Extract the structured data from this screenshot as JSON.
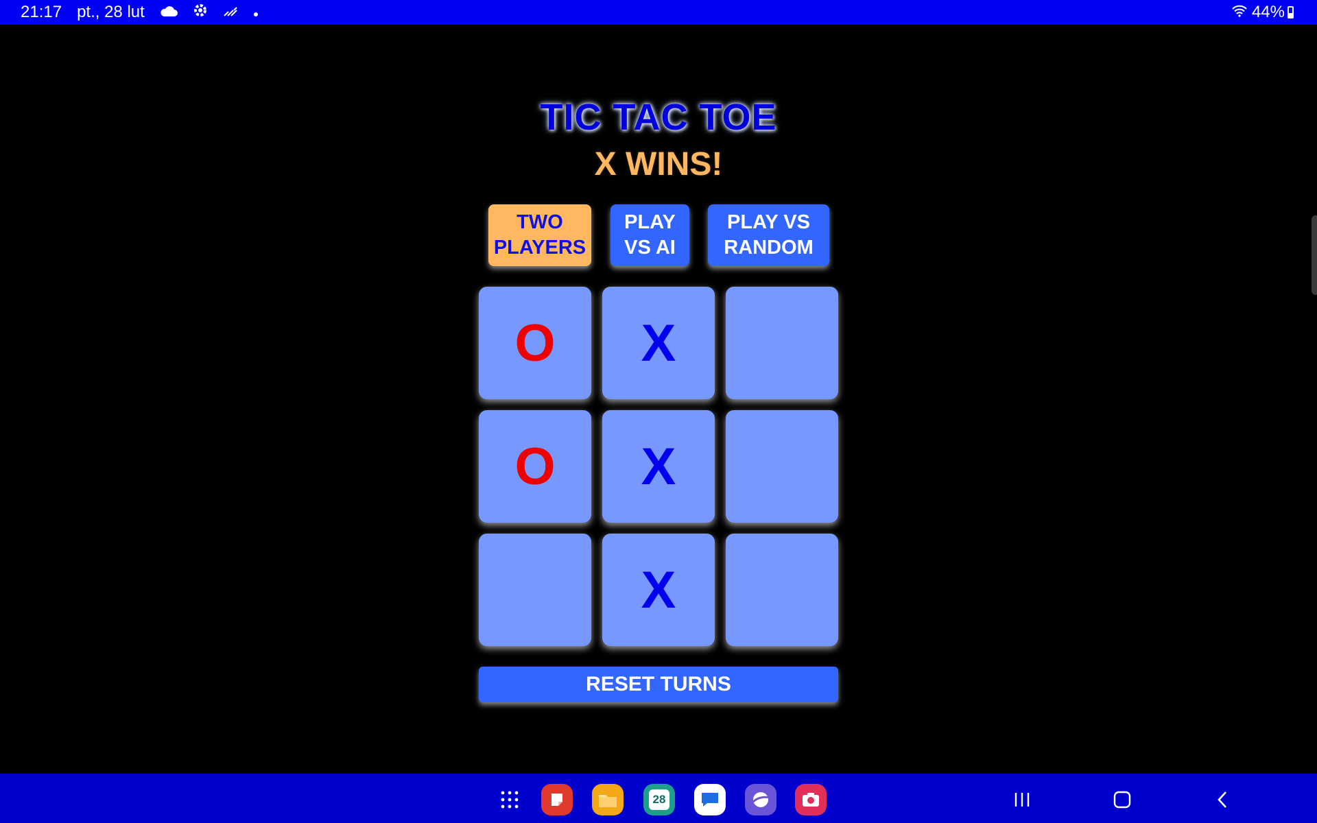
{
  "status_bar": {
    "time": "21:17",
    "date": "pt., 28 lut",
    "icons": [
      "cloud-icon",
      "gear-icon",
      "weather-icon",
      "dot-icon"
    ],
    "battery_percent": "44%",
    "battery_level": 0.44
  },
  "game": {
    "title": "TIC TAC TOE",
    "status": "X WINS!",
    "modes": [
      {
        "label": "TWO\nPLAYERS",
        "active": true
      },
      {
        "label": "PLAY\nVS AI",
        "active": false
      },
      {
        "label": "PLAY VS\nRANDOM",
        "active": false
      }
    ],
    "board": [
      [
        "O",
        "X",
        ""
      ],
      [
        "O",
        "X",
        ""
      ],
      [
        "",
        "X",
        ""
      ]
    ],
    "reset_label": "RESET TURNS",
    "colors": {
      "x_mark": "#0000ee",
      "o_mark": "#ee0000",
      "cell": "#7799ff",
      "active_mode": "#ffb860",
      "inactive_mode": "#3366ff",
      "title": "#0000dd",
      "status": "#ffb860"
    }
  },
  "taskbar": {
    "apps": [
      "apps-grid-icon",
      "notes-app-icon",
      "files-app-icon",
      "calendar-app-icon",
      "messages-app-icon",
      "browser-app-icon",
      "camera-app-icon"
    ],
    "calendar_day": "28",
    "nav": [
      "recents-icon",
      "home-icon",
      "back-icon"
    ]
  }
}
